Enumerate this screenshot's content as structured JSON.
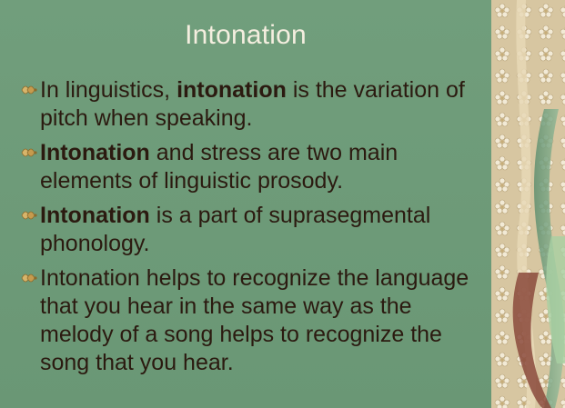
{
  "slide": {
    "title": "Intonation",
    "bullets": [
      {
        "parts": [
          {
            "text": "In linguistics, ",
            "bold": false
          },
          {
            "text": "intonation",
            "bold": true
          },
          {
            "text": " is the variation of pitch when speaking.",
            "bold": false
          }
        ]
      },
      {
        "parts": [
          {
            "text": "Intonation",
            "bold": true
          },
          {
            "text": " and stress are two main elements of linguistic prosody.",
            "bold": false
          }
        ]
      },
      {
        "parts": [
          {
            "text": "Intonation",
            "bold": true
          },
          {
            "text": " is a part of suprasegmental phonology.",
            "bold": false
          }
        ]
      },
      {
        "parts": [
          {
            "text": "Intonation helps to recognize the language that you hear in the same way as the melody of a song helps to recognize the song that you hear.",
            "bold": false
          }
        ]
      }
    ]
  },
  "colors": {
    "background": "#6d9a78",
    "title": "#f4eedf",
    "body_text": "#2b1a10",
    "marker": "#c9a55a",
    "panel": "#d8c7a3"
  },
  "icons": {
    "bullet": "ornamental-bullet-icon"
  }
}
